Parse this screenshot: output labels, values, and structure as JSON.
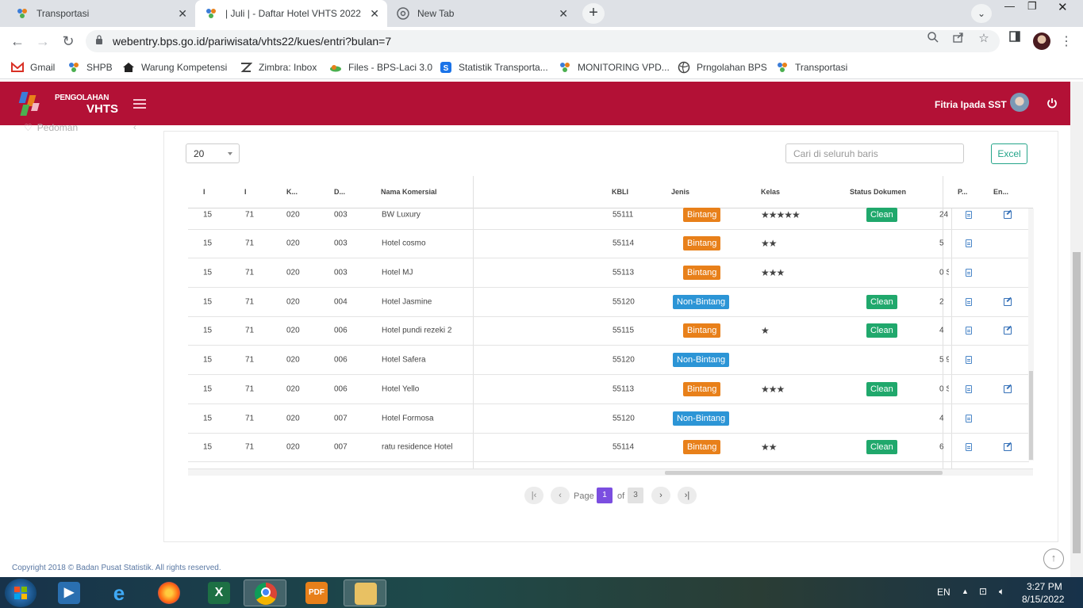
{
  "browser": {
    "tabs": [
      {
        "title": "Transportasi",
        "active": false
      },
      {
        "title": "| Juli | - Daftar Hotel VHTS 2022",
        "active": true
      },
      {
        "title": "New Tab",
        "active": false
      }
    ],
    "url": "webentry.bps.go.id/pariwisata/vhts22/kues/entri?bulan=7",
    "bookmarks": [
      {
        "label": "Gmail",
        "icon": "gmail-icon"
      },
      {
        "label": "SHPB",
        "icon": "bps-icon"
      },
      {
        "label": "Warung Kompetensi",
        "icon": "house-icon"
      },
      {
        "label": "Zimbra: Inbox",
        "icon": "zimbra-icon"
      },
      {
        "label": "Files - BPS-Laci 3.0",
        "icon": "cloud-icon"
      },
      {
        "label": "Statistik Transporta...",
        "icon": "s-icon"
      },
      {
        "label": "MONITORING VPD...",
        "icon": "bps-icon"
      },
      {
        "label": "Prngolahan BPS",
        "icon": "globe-icon"
      },
      {
        "label": "Transportasi",
        "icon": "bps-icon"
      }
    ]
  },
  "app": {
    "logo_top": "PENGOLAHAN",
    "logo_bottom": "VHTS",
    "user_name": "Fitria Ipada SST",
    "sidebar_item": "Pedoman",
    "footer": "Copyright 2018 © Badan Pusat Statistik. All rights reserved."
  },
  "controls": {
    "page_size": "20",
    "search_placeholder": "Cari di seluruh baris",
    "excel_label": "Excel"
  },
  "table": {
    "headers": {
      "c1": "I",
      "c2": "I",
      "c3": "K...",
      "c4": "D...",
      "nama": "Nama Komersial",
      "kbli": "KBLI",
      "jenis": "Jenis",
      "kelas": "Kelas",
      "status": "Status Dokumen",
      "p": "P...",
      "en": "En..."
    },
    "rows": [
      {
        "c1": "15",
        "c2": "71",
        "c3": "020",
        "c4": "003",
        "nama": "BW Luxury",
        "kbli": "55111",
        "jenis": "Bintang",
        "kelas": "★★★★★",
        "status": "Clean",
        "trunc": "24",
        "edit": true
      },
      {
        "c1": "15",
        "c2": "71",
        "c3": "020",
        "c4": "003",
        "nama": "Hotel cosmo",
        "kbli": "55114",
        "jenis": "Bintang",
        "kelas": "★★",
        "status": "",
        "trunc": "5",
        "edit": false
      },
      {
        "c1": "15",
        "c2": "71",
        "c3": "020",
        "c4": "003",
        "nama": "Hotel MJ",
        "kbli": "55113",
        "jenis": "Bintang",
        "kelas": "★★★",
        "status": "",
        "trunc": "0 S",
        "edit": false
      },
      {
        "c1": "15",
        "c2": "71",
        "c3": "020",
        "c4": "004",
        "nama": "Hotel Jasmine",
        "kbli": "55120",
        "jenis": "Non-Bintang",
        "kelas": "",
        "status": "Clean",
        "trunc": "2",
        "edit": true
      },
      {
        "c1": "15",
        "c2": "71",
        "c3": "020",
        "c4": "006",
        "nama": "Hotel pundi rezeki 2",
        "kbli": "55115",
        "jenis": "Bintang",
        "kelas": "★",
        "status": "Clean",
        "trunc": "4",
        "edit": true
      },
      {
        "c1": "15",
        "c2": "71",
        "c3": "020",
        "c4": "006",
        "nama": "Hotel Safera",
        "kbli": "55120",
        "jenis": "Non-Bintang",
        "kelas": "",
        "status": "",
        "trunc": "5 9",
        "edit": false
      },
      {
        "c1": "15",
        "c2": "71",
        "c3": "020",
        "c4": "006",
        "nama": "Hotel Yello",
        "kbli": "55113",
        "jenis": "Bintang",
        "kelas": "★★★",
        "status": "Clean",
        "trunc": "0 S",
        "edit": true
      },
      {
        "c1": "15",
        "c2": "71",
        "c3": "020",
        "c4": "007",
        "nama": "Hotel Formosa",
        "kbli": "55120",
        "jenis": "Non-Bintang",
        "kelas": "",
        "status": "",
        "trunc": "4",
        "edit": false
      },
      {
        "c1": "15",
        "c2": "71",
        "c3": "020",
        "c4": "007",
        "nama": "ratu residence Hotel",
        "kbli": "55114",
        "jenis": "Bintang",
        "kelas": "★★",
        "status": "Clean",
        "trunc": "6",
        "edit": true
      }
    ]
  },
  "pagination": {
    "page_label": "Page",
    "current": "1",
    "of_label": "of",
    "total": "3"
  },
  "taskbar": {
    "lang": "EN",
    "time": "3:27 PM",
    "date": "8/15/2022",
    "pdf_label": "PDF"
  },
  "colors": {
    "app_header": "#b31136",
    "bintang": "#e8801a",
    "non_bintang": "#2c95d6",
    "clean": "#20a86c",
    "current_page": "#7b4ee0"
  }
}
